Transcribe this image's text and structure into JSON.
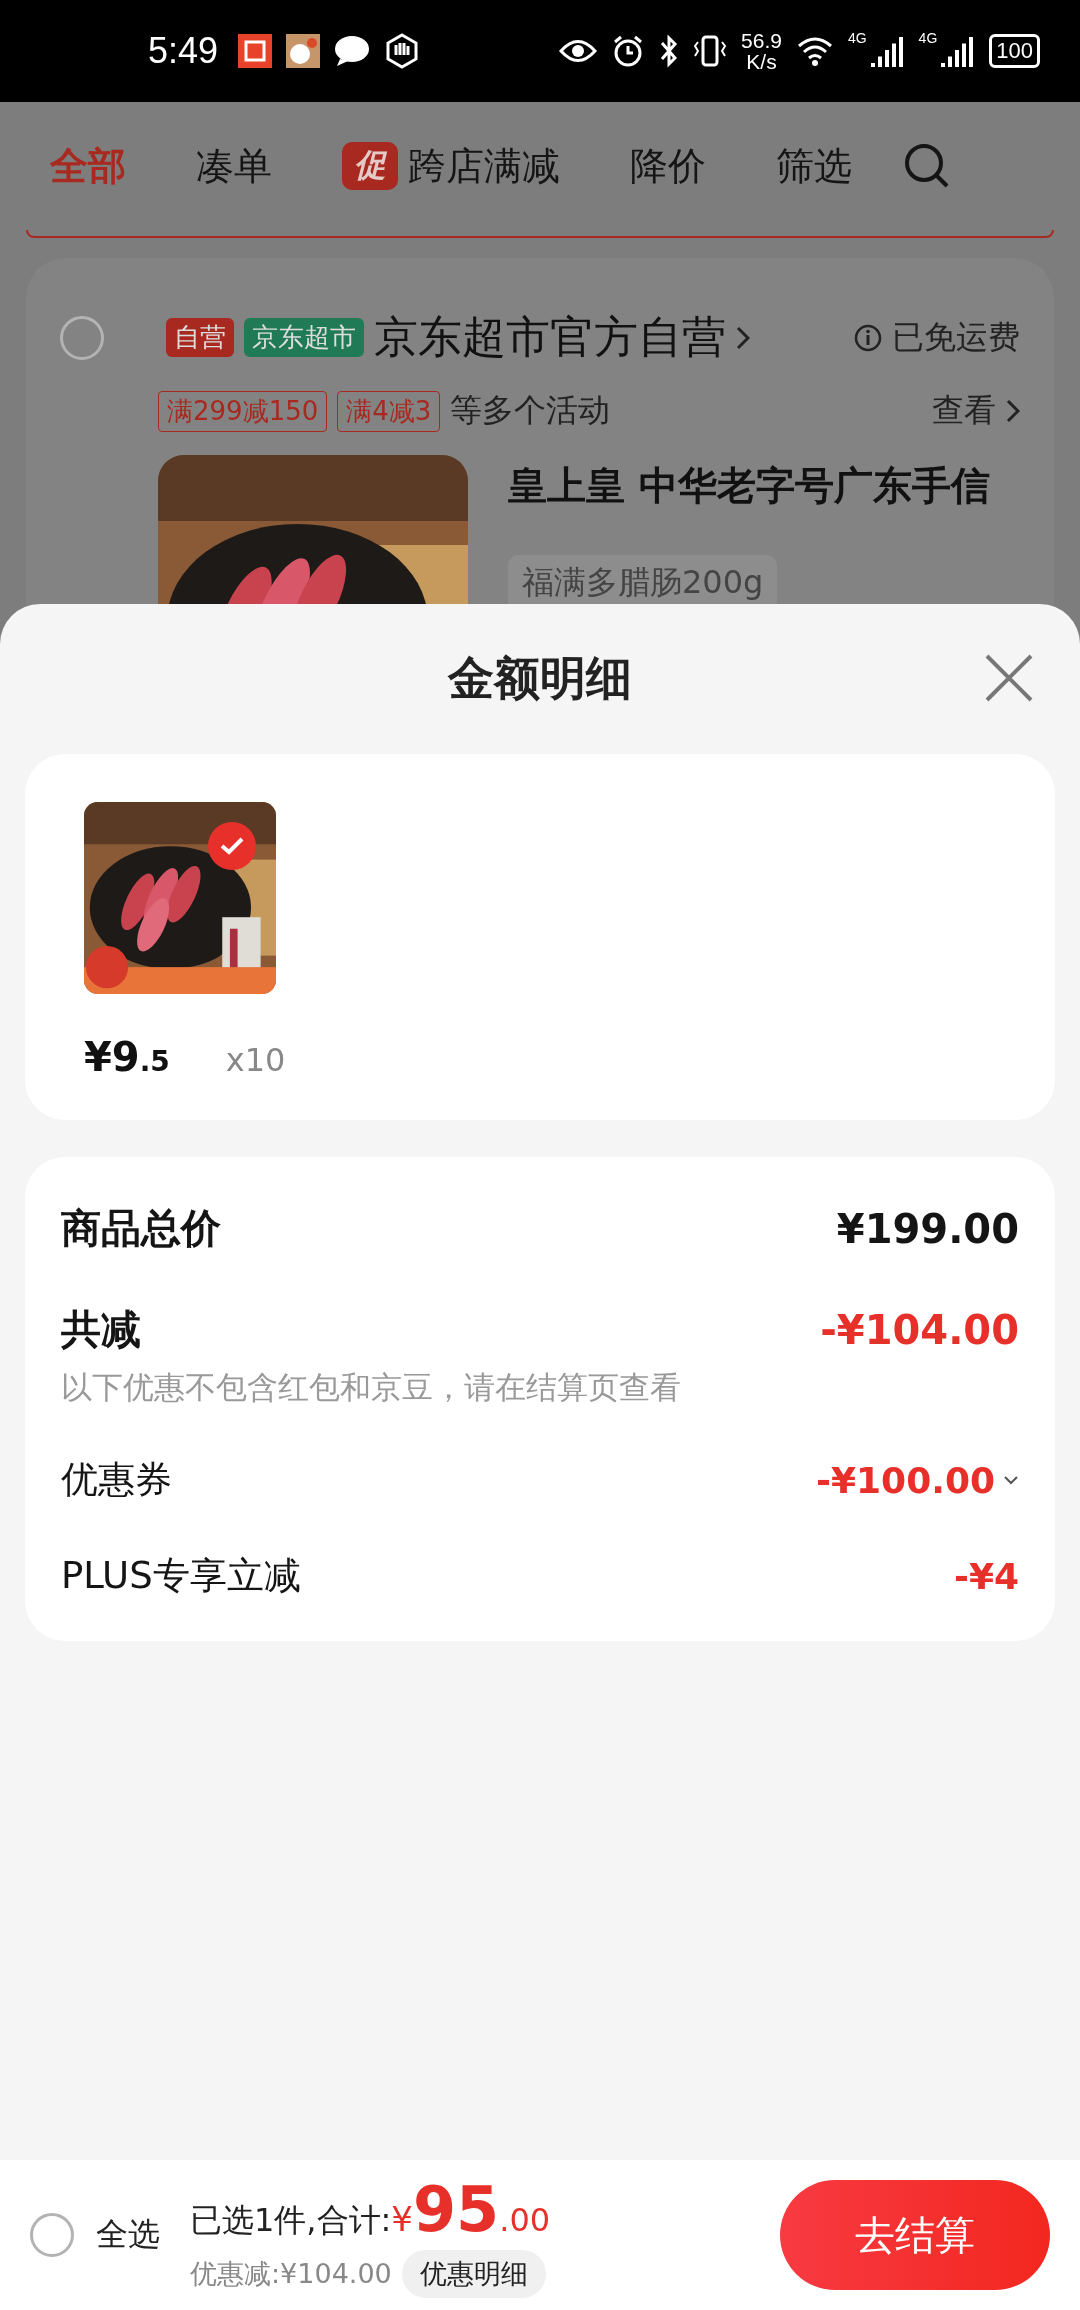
{
  "status_bar": {
    "time": "5:49",
    "speed_value": "56.9",
    "speed_unit": "K/s",
    "networks": [
      "4G",
      "4G"
    ],
    "battery": "100"
  },
  "tabs": [
    {
      "label": "全部",
      "selected": true
    },
    {
      "label": "凑单",
      "selected": false
    },
    {
      "label": "跨店满减",
      "selected": false,
      "badge": "促"
    },
    {
      "label": "降价",
      "selected": false
    },
    {
      "label": "筛选",
      "selected": false
    }
  ],
  "store": {
    "checked": false,
    "tags": [
      {
        "label": "自营",
        "color": "#a8291f"
      },
      {
        "label": "京东超市",
        "color": "#1f7a55"
      }
    ],
    "name": "京东超市官方自营",
    "shipping": "已免运费",
    "promos": [
      "满299减150",
      "满4减3"
    ],
    "promo_note": "等多个活动",
    "view": "查看",
    "product": {
      "title": "皇上皇 中华老字号广东手信",
      "spec": "福满多腊肠200g"
    }
  },
  "sheet": {
    "title": "金额明细",
    "products": [
      {
        "price_symbol": "¥",
        "price_int": "9",
        "price_dec": ".5",
        "quantity": "x10",
        "selected": true
      }
    ],
    "summary": [
      {
        "kind": "total",
        "label": "商品总价",
        "value": "¥199.00"
      },
      {
        "kind": "discount",
        "label": "共减",
        "value": "-¥104.00",
        "note": "以下优惠不包含红包和京豆，请在结算页查看"
      },
      {
        "kind": "item",
        "label": "优惠券",
        "value": "-¥100.00",
        "expandable": true
      },
      {
        "kind": "item",
        "label": "PLUS专享立减",
        "value": "-¥4",
        "expandable": false
      }
    ]
  },
  "bottom_bar": {
    "select_all_checked": false,
    "select_all": "全选",
    "selected_text": "已选1件,合计:",
    "total_symbol": "¥",
    "total_int": "95",
    "total_dec": ".00",
    "discount": "优惠减:¥104.00",
    "detail_button": "优惠明细",
    "checkout": "去结算"
  }
}
